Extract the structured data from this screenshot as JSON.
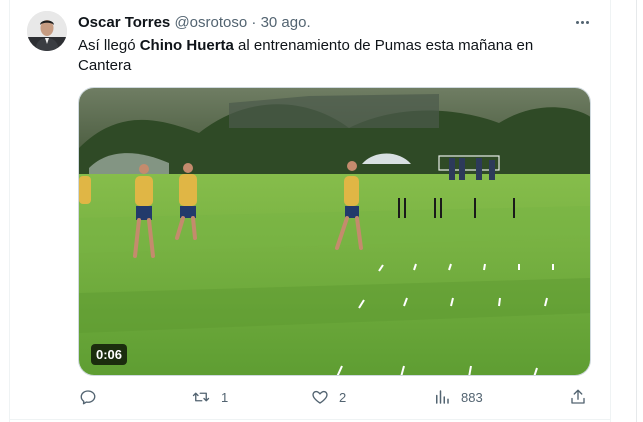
{
  "tweet": {
    "author_name": "Oscar Torres",
    "author_handle": "@osrotoso",
    "separator": "·",
    "date": "30 ago.",
    "text_parts": [
      {
        "text": "Así llegó ",
        "bold": false
      },
      {
        "text": "Chino Huerta",
        "bold": true
      },
      {
        "text": " al entrenamiento de Pumas esta mañana en Cantera",
        "bold": false
      }
    ],
    "media": {
      "duration": "0:06"
    }
  },
  "actions": {
    "reply_count": "",
    "retweet_count": "1",
    "like_count": "2",
    "views_count": "883"
  },
  "icons": {
    "more": "more-horizontal-icon",
    "reply": "reply-icon",
    "retweet": "retweet-icon",
    "like": "heart-icon",
    "views": "views-chart-icon",
    "share": "share-icon"
  },
  "colors": {
    "text_primary": "#0f1419",
    "text_secondary": "#536471",
    "border": "#cfd9de",
    "grass": "#6fae3d"
  }
}
